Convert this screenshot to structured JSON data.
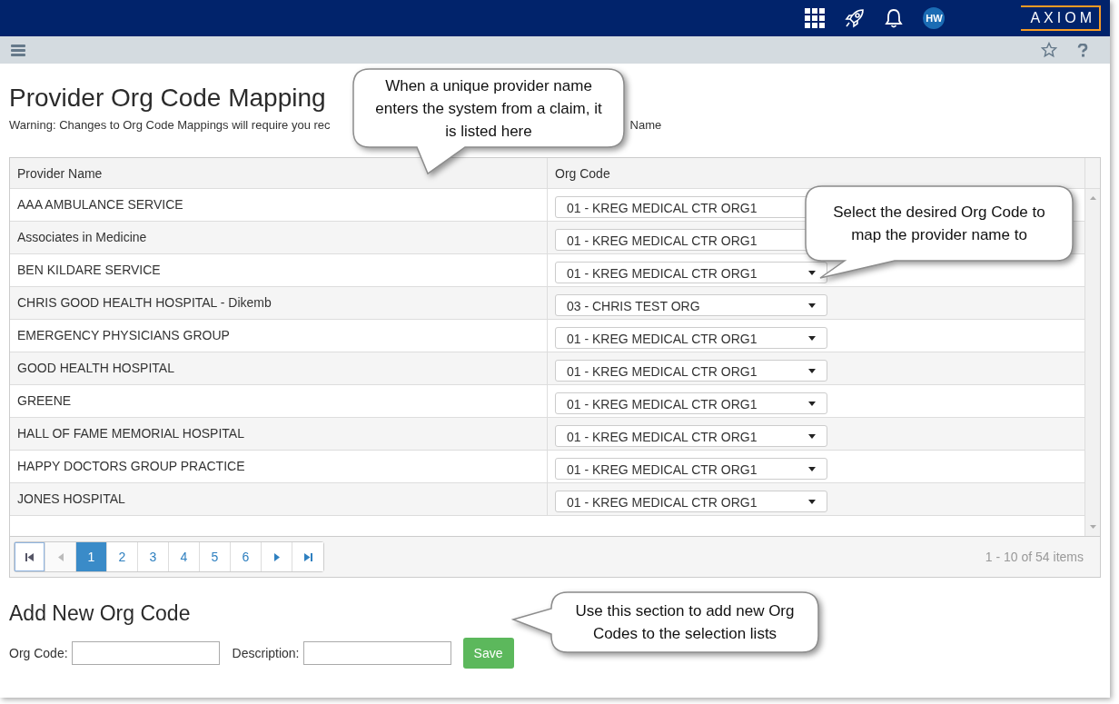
{
  "topbar": {
    "avatar": "HW",
    "logo": "AXIOM"
  },
  "page": {
    "title": "Provider Org Code Mapping",
    "warning_start": "Warning: Changes to Org Code Mappings will require you rec",
    "warning_end": "Name"
  },
  "table": {
    "columns": [
      "Provider Name",
      "Org Code"
    ],
    "rows": [
      {
        "provider": "AAA AMBULANCE SERVICE",
        "org_code": "01 - KREG MEDICAL CTR ORG1"
      },
      {
        "provider": "Associates in Medicine",
        "org_code": "01 - KREG MEDICAL CTR ORG1"
      },
      {
        "provider": "BEN KILDARE SERVICE",
        "org_code": "01 - KREG MEDICAL CTR ORG1"
      },
      {
        "provider": "CHRIS GOOD HEALTH HOSPITAL - Dikemb",
        "org_code": "03 - CHRIS TEST ORG"
      },
      {
        "provider": "EMERGENCY PHYSICIANS GROUP",
        "org_code": "01 - KREG MEDICAL CTR ORG1"
      },
      {
        "provider": "GOOD HEALTH HOSPITAL",
        "org_code": "01 - KREG MEDICAL CTR ORG1"
      },
      {
        "provider": "GREENE",
        "org_code": "01 - KREG MEDICAL CTR ORG1"
      },
      {
        "provider": "HALL OF FAME MEMORIAL HOSPITAL",
        "org_code": "01 - KREG MEDICAL CTR ORG1"
      },
      {
        "provider": "HAPPY DOCTORS GROUP PRACTICE",
        "org_code": "01 - KREG MEDICAL CTR ORG1"
      },
      {
        "provider": "JONES HOSPITAL",
        "org_code": "01 - KREG MEDICAL CTR ORG1"
      }
    ]
  },
  "pager": {
    "nav_before": [
      {
        "kind": "first",
        "disabled": false
      },
      {
        "kind": "prev",
        "disabled": true
      }
    ],
    "pages": [
      {
        "label": "1",
        "selected": true
      },
      {
        "label": "2",
        "selected": false
      },
      {
        "label": "3",
        "selected": false
      },
      {
        "label": "4",
        "selected": false
      },
      {
        "label": "5",
        "selected": false
      },
      {
        "label": "6",
        "selected": false
      }
    ],
    "nav_after": [
      {
        "kind": "next",
        "disabled": false
      },
      {
        "kind": "last",
        "disabled": false
      }
    ],
    "summary": "1 - 10 of 54 items"
  },
  "add_form": {
    "title": "Add New Org Code",
    "org_code_label": "Org Code:",
    "description_label": "Description:",
    "save": "Save"
  },
  "callouts": [
    {
      "kind": "down-left",
      "text": "When a unique provider name enters the system from a claim, it is listed here"
    },
    {
      "kind": "down-left-far",
      "text": "Select the desired Org Code to map the provider name to"
    },
    {
      "kind": "left",
      "text": "Use this section to add new Org Codes to the selection lists"
    }
  ]
}
